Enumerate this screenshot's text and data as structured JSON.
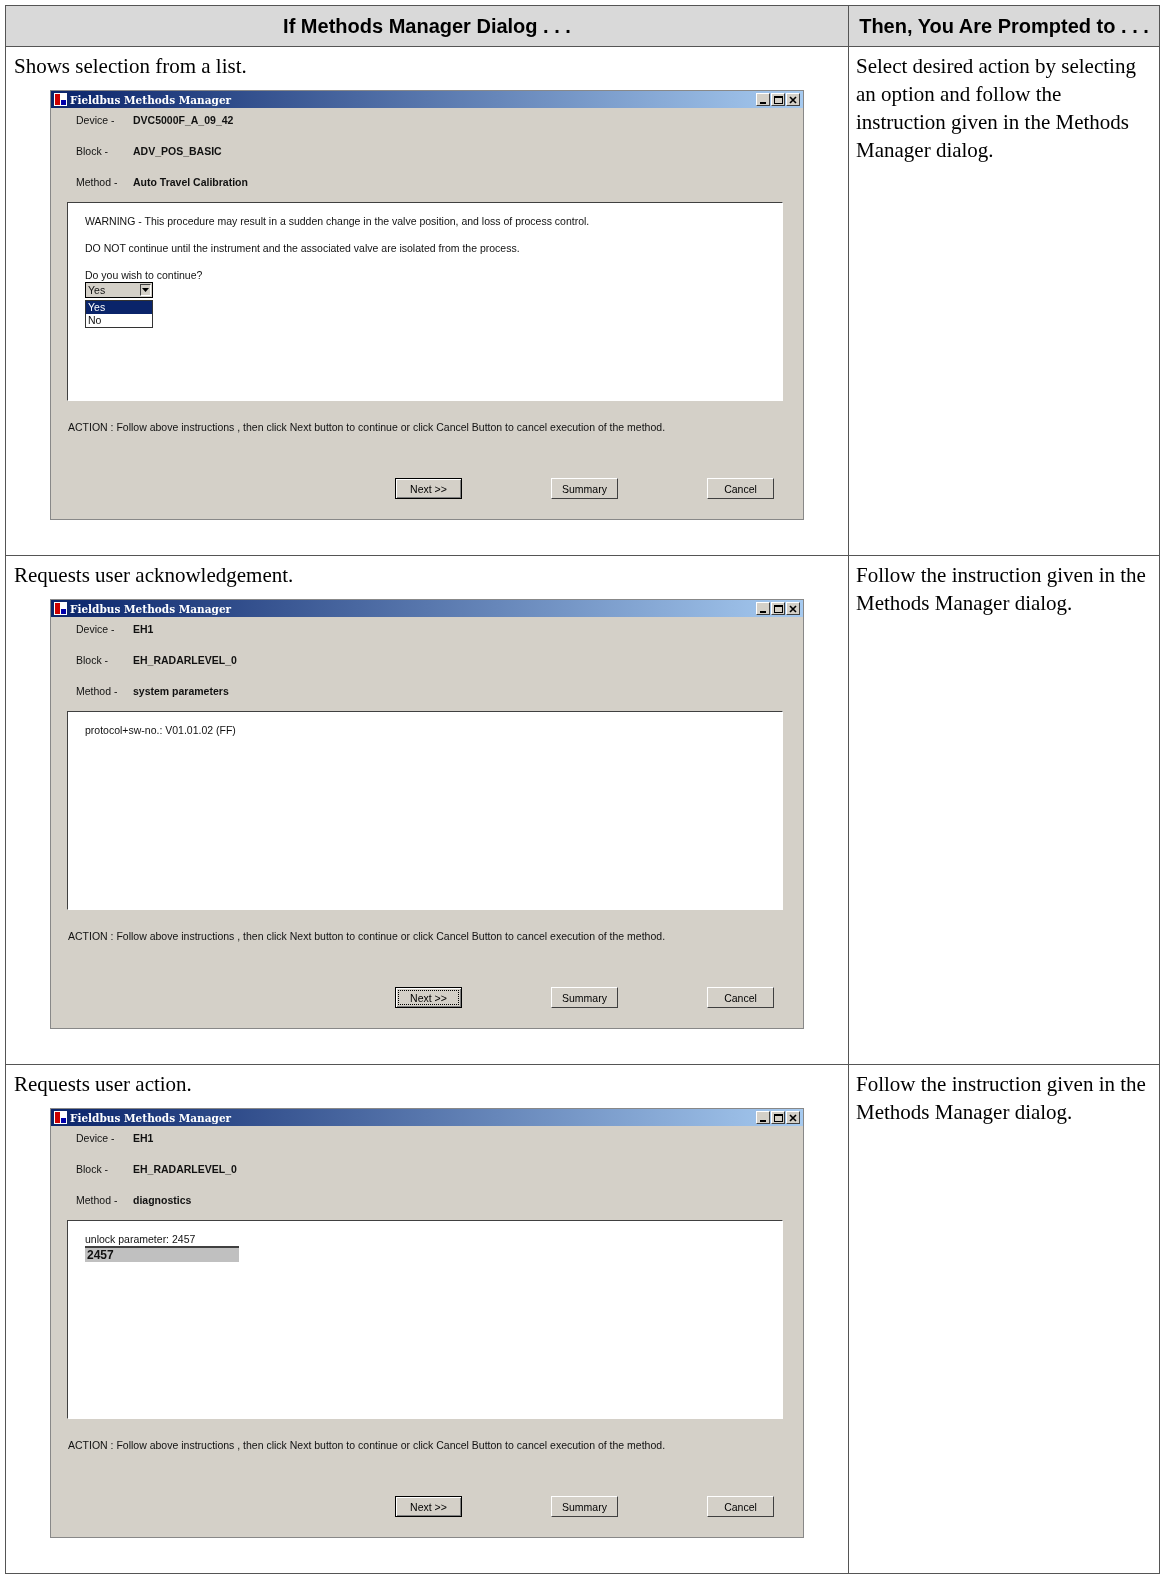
{
  "table": {
    "columns": [
      "If Methods Manager Dialog . . .",
      "Then, You Are Prompted to . . ."
    ],
    "rows": [
      {
        "description": "Shows selection from a list.",
        "prompt": "Select desired action by selecting an option and follow the instruction given in the Methods Manager dialog.",
        "dialog": {
          "title": "Fieldbus Methods Manager",
          "fields": [
            {
              "label": "Device -",
              "value": "DVC5000F_A_09_42"
            },
            {
              "label": "Block -",
              "value": "ADV_POS_BASIC"
            },
            {
              "label": "Method -",
              "value": "Auto Travel Calibration"
            }
          ],
          "content": [
            {
              "kind": "text",
              "text": "WARNING - This procedure may result in a sudden change in the valve position, and loss of process control."
            },
            {
              "kind": "text",
              "text": "DO NOT continue until the instrument and the associated valve are isolated from the process."
            },
            {
              "kind": "label",
              "text": "Do you wish to continue?"
            },
            {
              "kind": "dropdown",
              "value": "Yes",
              "expanded": true,
              "options": [
                {
                  "label": "Yes",
                  "selected": true
                },
                {
                  "label": "No",
                  "selected": false
                }
              ]
            }
          ],
          "action": "ACTION : Follow above instructions , then click Next button to continue or click Cancel Button to cancel execution of the method.",
          "buttons": [
            {
              "label": "Next >>",
              "focused": false
            },
            {
              "label": "Summary",
              "focused": false
            },
            {
              "label": "Cancel",
              "focused": false
            }
          ]
        }
      },
      {
        "description": "Requests user acknowledgement.",
        "prompt": "Follow the instruction given in the Methods Manager dialog.",
        "dialog": {
          "title": "Fieldbus Methods Manager",
          "fields": [
            {
              "label": "Device -",
              "value": "EH1"
            },
            {
              "label": "Block -",
              "value": "EH_RADARLEVEL_0"
            },
            {
              "label": "Method -",
              "value": "system parameters"
            }
          ],
          "content": [
            {
              "kind": "text",
              "text": "protocol+sw-no.: V01.01.02 (FF)"
            }
          ],
          "action": "ACTION : Follow above instructions , then click Next button to continue or click Cancel Button to cancel execution of the method.",
          "buttons": [
            {
              "label": "Next >>",
              "focused": true
            },
            {
              "label": "Summary",
              "focused": false
            },
            {
              "label": "Cancel",
              "focused": false
            }
          ]
        }
      },
      {
        "description": "Requests user action.",
        "prompt": "Follow the instruction given in the Methods Manager dialog.",
        "dialog": {
          "title": "Fieldbus Methods Manager",
          "fields": [
            {
              "label": "Device -",
              "value": "EH1"
            },
            {
              "label": "Block -",
              "value": "EH_RADARLEVEL_0"
            },
            {
              "label": "Method -",
              "value": "diagnostics"
            }
          ],
          "content": [
            {
              "kind": "label",
              "text": "unlock parameter: 2457"
            },
            {
              "kind": "input",
              "value": "2457"
            }
          ],
          "action": "ACTION : Follow above instructions , then click Next button to continue or click Cancel Button to cancel execution of the method.",
          "buttons": [
            {
              "label": "Next >>",
              "focused": false
            },
            {
              "label": "Summary",
              "focused": false
            },
            {
              "label": "Cancel",
              "focused": false
            }
          ]
        }
      }
    ]
  }
}
